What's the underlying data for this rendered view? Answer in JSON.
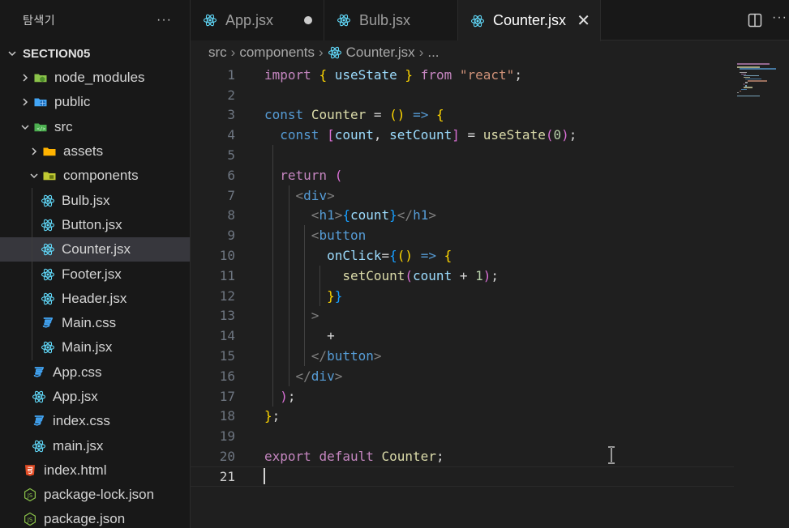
{
  "sidebar": {
    "title": "탐색기",
    "more": "···",
    "root": "SECTION05",
    "items": [
      {
        "label": "node_modules",
        "icon": "node-folder-icon",
        "depth": 1,
        "chevron": "right"
      },
      {
        "label": "public",
        "icon": "public-folder-icon",
        "depth": 1,
        "chevron": "right"
      },
      {
        "label": "src",
        "icon": "src-folder-icon",
        "depth": 1,
        "chevron": "down"
      },
      {
        "label": "assets",
        "icon": "assets-folder-icon",
        "depth": 2,
        "chevron": "right"
      },
      {
        "label": "components",
        "icon": "components-folder-icon",
        "depth": 2,
        "chevron": "down"
      },
      {
        "label": "Bulb.jsx",
        "icon": "react-icon",
        "depth": 3
      },
      {
        "label": "Button.jsx",
        "icon": "react-icon",
        "depth": 3
      },
      {
        "label": "Counter.jsx",
        "icon": "react-icon",
        "depth": 3,
        "selected": true
      },
      {
        "label": "Footer.jsx",
        "icon": "react-icon",
        "depth": 3
      },
      {
        "label": "Header.jsx",
        "icon": "react-icon",
        "depth": 3
      },
      {
        "label": "Main.css",
        "icon": "css-icon",
        "depth": 3
      },
      {
        "label": "Main.jsx",
        "icon": "react-icon",
        "depth": 3
      },
      {
        "label": "App.css",
        "icon": "css-icon",
        "depth": 2
      },
      {
        "label": "App.jsx",
        "icon": "react-icon",
        "depth": 2
      },
      {
        "label": "index.css",
        "icon": "css-icon",
        "depth": 2
      },
      {
        "label": "main.jsx",
        "icon": "react-icon",
        "depth": 2
      },
      {
        "label": "index.html",
        "icon": "html-icon",
        "depth": 1
      },
      {
        "label": "package-lock.json",
        "icon": "json-icon",
        "depth": 1
      },
      {
        "label": "package.json",
        "icon": "json-icon",
        "depth": 1
      }
    ]
  },
  "tabs": [
    {
      "label": "App.jsx",
      "state": "dirty"
    },
    {
      "label": "Bulb.jsx",
      "state": "normal"
    },
    {
      "label": "Counter.jsx",
      "state": "active"
    }
  ],
  "tab_actions": {
    "more": "···"
  },
  "breadcrumb": {
    "parts": [
      "src",
      "components",
      "Counter.jsx",
      "..."
    ]
  },
  "editor": {
    "current_line": 21,
    "lines": [
      "import { useState } from \"react\";",
      "",
      "const Counter = () => {",
      "  const [count, setCount] = useState(0);",
      "",
      "  return (",
      "    <div>",
      "      <h1>{count}</h1>",
      "      <button",
      "        onClick={() => {",
      "          setCount(count + 1);",
      "        }}",
      "      >",
      "        +",
      "      </button>",
      "    </div>",
      "  );",
      "};",
      "",
      "export default Counter;",
      ""
    ]
  },
  "colors": {
    "keyword": "#c586c0",
    "storage": "#569cd6",
    "function": "#dcdcaa",
    "variable": "#9cdcfe",
    "string": "#ce9178",
    "number": "#b5cea8",
    "react": "#61dafb",
    "css": "#42a5f5",
    "html": "#e44d26",
    "json": "#cbcb41"
  }
}
